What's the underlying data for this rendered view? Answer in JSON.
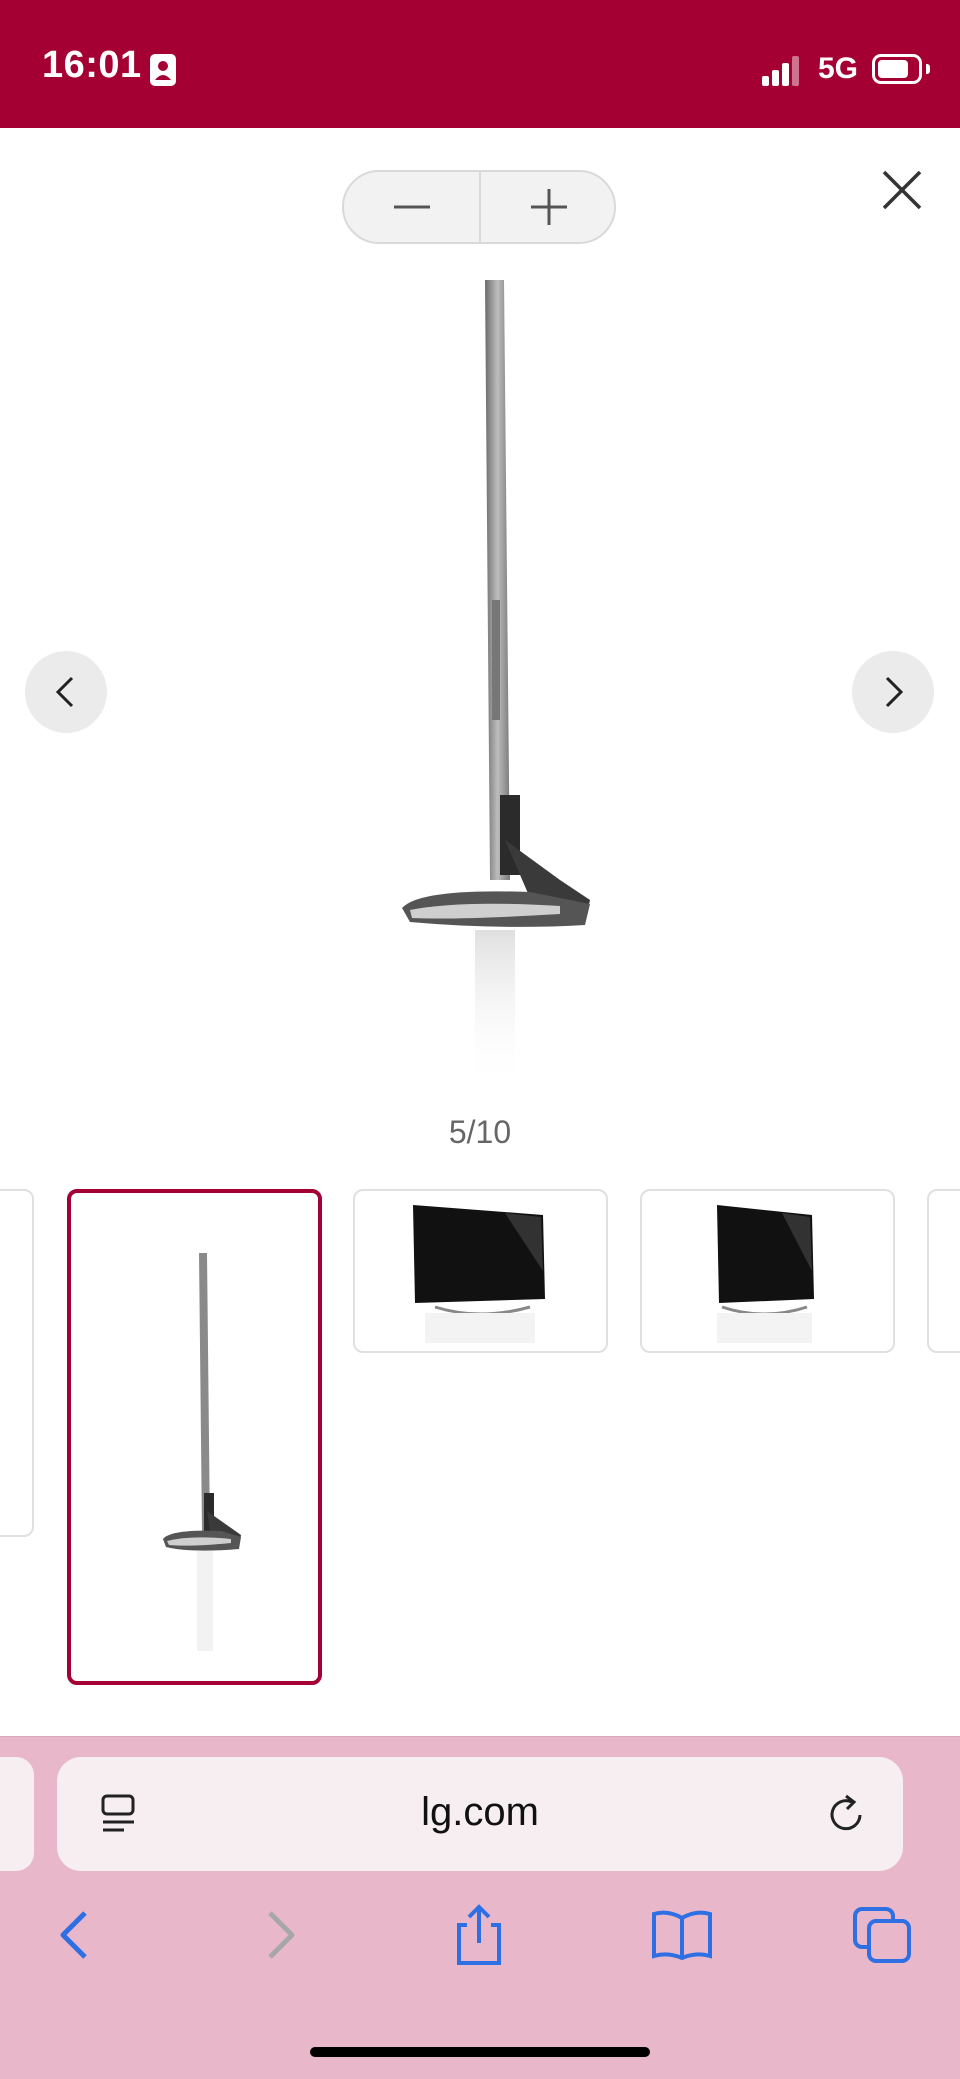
{
  "status_bar": {
    "time": "16:01",
    "network": "5G",
    "bg_color": "#a50034"
  },
  "zoom": {
    "decrease_icon": "minus-icon",
    "increase_icon": "plus-icon"
  },
  "close_icon": "close-icon",
  "gallery": {
    "current": 5,
    "total": 10,
    "counter_text": "5/10",
    "prev_icon": "chevron-left-icon",
    "next_icon": "chevron-right-icon",
    "accent_color": "#a50034",
    "thumbnails": [
      {
        "kind": "partial-left"
      },
      {
        "kind": "side-view",
        "active": true
      },
      {
        "kind": "front-angle-view",
        "active": false
      },
      {
        "kind": "front-angle-view",
        "active": false
      },
      {
        "kind": "partial-right"
      }
    ]
  },
  "browser": {
    "address": "lg.com",
    "chrome_color": "#e8b8ca",
    "icons": [
      "page-settings-icon",
      "reload-icon",
      "back-icon",
      "forward-icon",
      "share-icon",
      "bookmarks-icon",
      "tabs-icon"
    ],
    "icon_color": "#2f6fe4",
    "disabled_color": "#a7a7a7"
  }
}
